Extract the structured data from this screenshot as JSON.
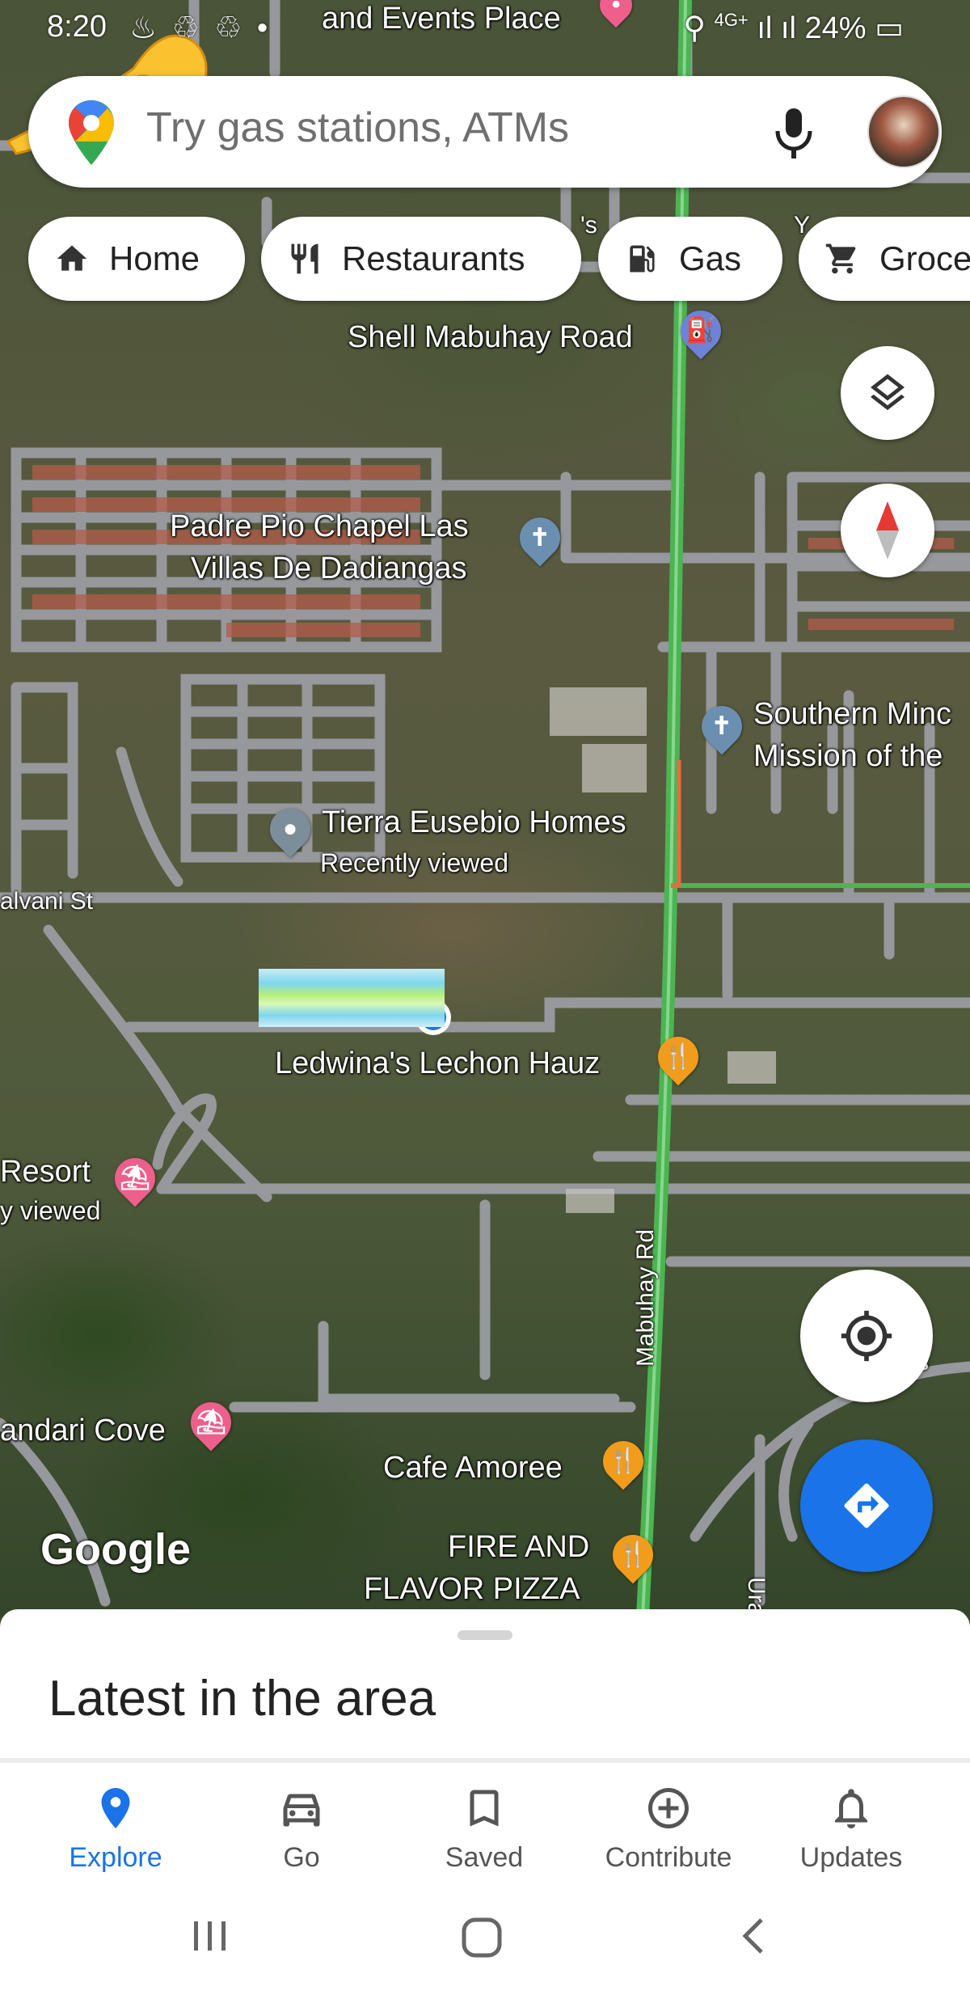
{
  "status_bar": {
    "time": "8:20",
    "left_icons": "♨ ♲ ♲ •",
    "network": "4G+",
    "battery": "24%"
  },
  "search": {
    "placeholder": "Try gas stations, ATMs"
  },
  "chips": [
    {
      "label": "Home",
      "icon": "home-icon"
    },
    {
      "label": "Restaurants",
      "icon": "restaurant-icon"
    },
    {
      "label": "Gas",
      "icon": "gas-icon"
    },
    {
      "label": "Groce",
      "icon": "cart-icon"
    }
  ],
  "map": {
    "places": {
      "events_place": "and Events Place",
      "shell": "Shell Mabuhay Road",
      "padre_pio_line1": "Padre Pio Chapel Las",
      "padre_pio_line2": "Villas De Dadiangas",
      "southern_line1": "Southern Minc",
      "southern_line2": "Mission of the",
      "tierra": "Tierra Eusebio Homes",
      "tierra_sub": "Recently viewed",
      "ledwina": "Ledwina's Lechon Hauz",
      "resort": "Resort",
      "resort_sub": "y viewed",
      "andari": "andari Cove",
      "cafe": "Cafe Amoree",
      "fire_line1": "FIRE AND",
      "fire_line2": "FLAVOR PIZZA"
    },
    "streets": {
      "galvani": "alvani St",
      "mabuhay": "Mabuhay Rd",
      "ura": "Ura",
      "s_fragment": "'s",
      "y_fragment": "Y",
      "s2_fragment": "s"
    },
    "watermark": "Google"
  },
  "sheet": {
    "title": "Latest in the area"
  },
  "bottom_nav": [
    {
      "label": "Explore",
      "icon": "explore-pin-icon",
      "active": true
    },
    {
      "label": "Go",
      "icon": "car-icon",
      "active": false
    },
    {
      "label": "Saved",
      "icon": "bookmark-icon",
      "active": false
    },
    {
      "label": "Contribute",
      "icon": "add-circle-icon",
      "active": false
    },
    {
      "label": "Updates",
      "icon": "bell-icon",
      "active": false
    }
  ],
  "colors": {
    "accent": "#1a73e8",
    "food_pin": "#f29c1b",
    "road": "#7c7f87",
    "main_road": "#53c35a"
  }
}
